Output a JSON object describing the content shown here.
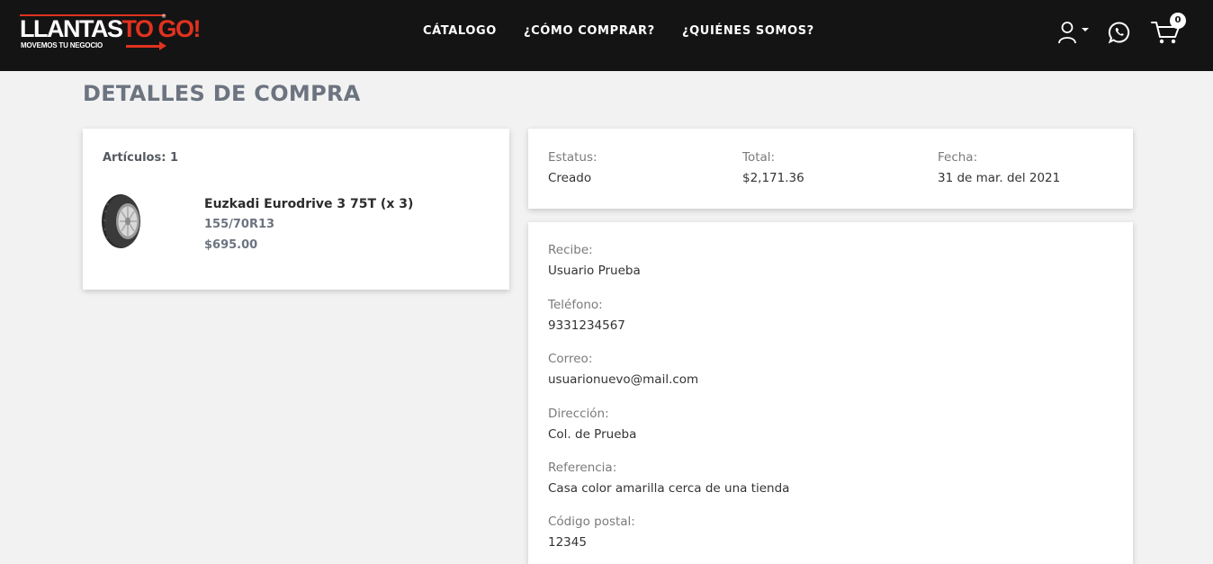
{
  "brand": {
    "logo_text_white": "LLANTAS",
    "logo_text_red": "TO GO!",
    "registered": "®",
    "tagline": "MOVEMOS TU NEGOCIO",
    "colors": {
      "header_bg": "#141414",
      "accent_red": "#e1321f",
      "title_gray": "#6c7480"
    }
  },
  "nav": {
    "catalogo": "CÁTALOGO",
    "como_comprar": "¿CÓMO COMPRAR?",
    "quienes_somos": "¿QUIÉNES SOMOS?"
  },
  "header_icons": {
    "user": "user-icon",
    "whatsapp": "whatsapp-icon",
    "cart": "cart-icon",
    "cart_count": "0"
  },
  "page": {
    "title": "DETALLES DE COMPRA"
  },
  "items_card": {
    "count_label": "Artículos: 1",
    "items": [
      {
        "name": "Euzkadi Eurodrive 3 75T (x 3)",
        "size": "155/70R13",
        "price": "$695.00",
        "image": "tire-image"
      }
    ]
  },
  "status_card": {
    "status_label": "Estatus:",
    "status_value": "Creado",
    "total_label": "Total:",
    "total_value": "$2,171.36",
    "date_label": "Fecha:",
    "date_value": "31 de mar. del 2021"
  },
  "info_card": {
    "fields": [
      {
        "label": "Recibe:",
        "value": "Usuario Prueba"
      },
      {
        "label": "Teléfono:",
        "value": "9331234567"
      },
      {
        "label": "Correo:",
        "value": "usuarionuevo@mail.com"
      },
      {
        "label": "Dirección:",
        "value": "Col. de Prueba"
      },
      {
        "label": "Referencia:",
        "value": "Casa color amarilla cerca de una tienda"
      },
      {
        "label": "Código postal:",
        "value": "12345"
      }
    ]
  }
}
